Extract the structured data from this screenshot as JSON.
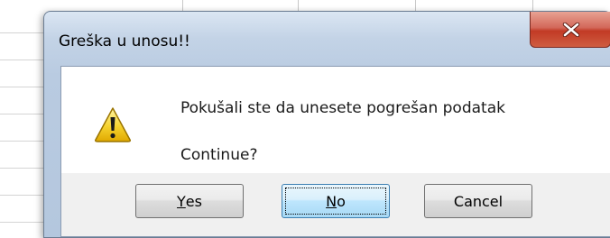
{
  "dialog": {
    "title": "Greška u unosu!!",
    "message": "Pokušali ste da unesete pogrešan podatak",
    "question": "Continue?",
    "icon": "warning-icon",
    "close_icon": "close-icon"
  },
  "buttons": {
    "yes": {
      "mnemonic": "Y",
      "rest": "es"
    },
    "no": {
      "mnemonic": "N",
      "rest": "o"
    },
    "cancel": {
      "label": "Cancel"
    }
  },
  "colors": {
    "close_button": "#c23a25",
    "focused_button_border": "#3c7fb1"
  }
}
